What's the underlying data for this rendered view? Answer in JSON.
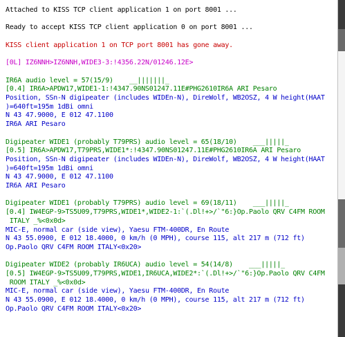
{
  "terminal": {
    "lines": [
      {
        "text": "Attached to KISS TCP client application 1 on port 8001 ...",
        "color": "black"
      },
      {
        "text": "",
        "color": "black"
      },
      {
        "text": "Ready to accept KISS TCP client application 0 on port 8001 ...",
        "color": "black"
      },
      {
        "text": "",
        "color": "black"
      },
      {
        "text": "KISS client application 1 on TCP port 8001 has gone away.",
        "color": "red"
      },
      {
        "text": "",
        "color": "black"
      },
      {
        "text": "[0L] IZ6NNH>IZ6NNH,WIDE3-3:!4356.22N/01246.12E>",
        "color": "magenta"
      },
      {
        "text": "",
        "color": "black"
      },
      {
        "text": "IR6A audio level = 57(15/9)    __|||||||_",
        "color": "green"
      },
      {
        "text": "[0.4] IR6A>APDW17,WIDE1-1:!4347.90NS01247.11E#PHG2610IR6A ARI Pesaro",
        "color": "green"
      },
      {
        "text": "Position, SSn-N digipeater (includes WIDEn-N), DireWolf, WB2OSZ, 4 W height(HAAT",
        "color": "blue"
      },
      {
        "text": ")=640ft=195m 1dBi omni",
        "color": "blue"
      },
      {
        "text": "N 43 47.9000, E 012 47.1100",
        "color": "blue"
      },
      {
        "text": "IR6A ARI Pesaro",
        "color": "blue"
      },
      {
        "text": "",
        "color": "black"
      },
      {
        "text": "Digipeater WIDE1 (probably T79PRS) audio level = 65(18/10)    ___|||||_",
        "color": "green"
      },
      {
        "text": "[0.5] IR6A>APDW17,T79PRS,WIDE1*:!4347.90NS01247.11E#PHG2610IR6A ARI Pesaro",
        "color": "green"
      },
      {
        "text": "Position, SSn-N digipeater (includes WIDEn-N), DireWolf, WB2OSZ, 4 W height(HAAT",
        "color": "blue"
      },
      {
        "text": ")=640ft=195m 1dBi omni",
        "color": "blue"
      },
      {
        "text": "N 43 47.9000, E 012 47.1100",
        "color": "blue"
      },
      {
        "text": "IR6A ARI Pesaro",
        "color": "blue"
      },
      {
        "text": "",
        "color": "black"
      },
      {
        "text": "Digipeater WIDE1 (probably T79PRS) audio level = 69(18/11)    ___|||||_",
        "color": "green"
      },
      {
        "text": "[0.4] IW4EGP-9>TS5U09,T79PRS,WIDE1*,WIDE2-1:`(.Dl!+>/`\"6:}Op.Paolo QRV C4FM ROOM",
        "color": "green"
      },
      {
        "text": " ITALY _%<0x0d>",
        "color": "green"
      },
      {
        "text": "MIC-E, normal car (side view), Yaesu FTM-400DR, En Route",
        "color": "blue"
      },
      {
        "text": "N 43 55.0900, E 012 18.4000, 0 km/h (0 MPH), course 115, alt 217 m (712 ft)",
        "color": "blue"
      },
      {
        "text": "Op.Paolo QRV C4FM ROOM ITALY<0x20>",
        "color": "blue"
      },
      {
        "text": "",
        "color": "black"
      },
      {
        "text": "Digipeater WIDE2 (probably IR6UCA) audio level = 54(14/8)    ___|||||_",
        "color": "green"
      },
      {
        "text": "[0.5] IW4EGP-9>TS5U09,T79PRS,WIDE1,IR6UCA,WIDE2*:`(.Dl!+>/`\"6:}Op.Paolo QRV C4FM",
        "color": "green"
      },
      {
        "text": " ROOM ITALY _%<0x0d>",
        "color": "green"
      },
      {
        "text": "MIC-E, normal car (side view), Yaesu FTM-400DR, En Route",
        "color": "blue"
      },
      {
        "text": "N 43 55.0900, E 012 18.4000, 0 km/h (0 MPH), course 115, alt 217 m (712 ft)",
        "color": "blue"
      },
      {
        "text": "Op.Paolo QRV C4FM ROOM ITALY<0x20>",
        "color": "blue"
      }
    ]
  },
  "colors": {
    "black": "#000000",
    "red": "#c80000",
    "magenta": "#c800c8",
    "green": "#008000",
    "blue": "#0000c8"
  }
}
